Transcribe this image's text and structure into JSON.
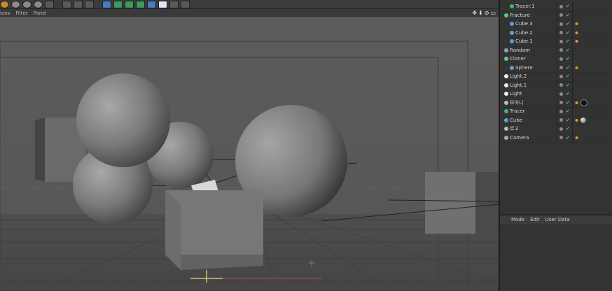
{
  "viewport": {
    "menu": [
      "ions",
      "Filter",
      "Panel"
    ],
    "nav_icons": [
      "move-icon",
      "down-arrow-icon",
      "zoom-icon",
      "maximize-icon"
    ]
  },
  "objects": [
    {
      "name": "Tracer.1",
      "depth": 1,
      "icon": "tracer",
      "tags": 0
    },
    {
      "name": "Fracture",
      "depth": 0,
      "icon": "fracture",
      "tags": 0
    },
    {
      "name": "Cube.3",
      "depth": 1,
      "icon": "cube",
      "tags": 1
    },
    {
      "name": "Cube.2",
      "depth": 1,
      "icon": "cube",
      "tags": 1
    },
    {
      "name": "Cube.1",
      "depth": 1,
      "icon": "cube",
      "tags": 1
    },
    {
      "name": "Random",
      "depth": 0,
      "icon": "random",
      "tags": 0
    },
    {
      "name": "Cloner",
      "depth": 0,
      "icon": "cloner",
      "tags": 0
    },
    {
      "name": "Sphere",
      "depth": 1,
      "icon": "sphere",
      "tags": 1
    },
    {
      "name": "Light.2",
      "depth": 0,
      "icon": "light",
      "tags": 0
    },
    {
      "name": "Light.1",
      "depth": 0,
      "icon": "light",
      "tags": 0
    },
    {
      "name": "Light",
      "depth": 0,
      "icon": "light",
      "tags": 0
    },
    {
      "name": "모아니",
      "depth": 0,
      "icon": "null",
      "tags": 2
    },
    {
      "name": "Tracer",
      "depth": 0,
      "icon": "tracer",
      "tags": 0
    },
    {
      "name": "Cube",
      "depth": 0,
      "icon": "cube",
      "tags": 3
    },
    {
      "name": "로고",
      "depth": 0,
      "icon": "null",
      "tags": 0
    },
    {
      "name": "Camera",
      "depth": 0,
      "icon": "camera",
      "tags": 4
    }
  ],
  "attributes": {
    "mode": "Mode",
    "edit": "Edit",
    "user_data": "User Data"
  },
  "colors": {
    "check": "#4ec06a",
    "tag": "#e8962a",
    "background": "#585858"
  }
}
